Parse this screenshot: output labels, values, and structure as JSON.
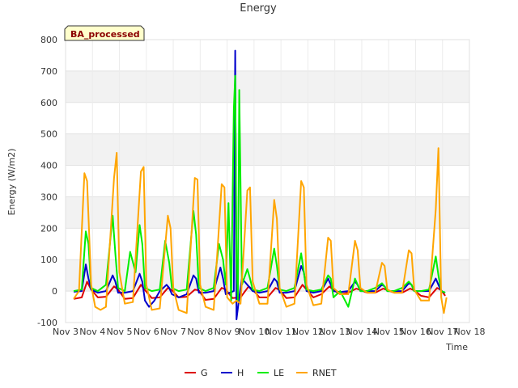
{
  "chart_data": {
    "type": "line",
    "title": "Energy",
    "badge": "BA_processed",
    "xlabel": "Time",
    "ylabel": "Energy (W/m2)",
    "ylim": [
      -100,
      800
    ],
    "xlim": [
      3,
      18
    ],
    "yticks": [
      -100,
      0,
      100,
      200,
      300,
      400,
      500,
      600,
      700,
      800
    ],
    "xticks": [
      3,
      4,
      5,
      6,
      7,
      8,
      9,
      10,
      11,
      12,
      13,
      14,
      15,
      16,
      17,
      18
    ],
    "xtick_labels": [
      "Nov 3",
      "Nov 4",
      "Nov 5",
      "Nov 6",
      "Nov 7",
      "Nov 8",
      "Nov 9",
      "Nov 10",
      "Nov 11",
      "Nov 12",
      "Nov 13",
      "Nov 14",
      "Nov 15",
      "Nov 16",
      "Nov 17",
      "Nov 18"
    ],
    "grid": true,
    "banded_background": true,
    "legend_position": "bottom",
    "series": [
      {
        "name": "G",
        "color": "#dd0000",
        "x": [
          3.3,
          3.6,
          3.8,
          3.95,
          4.2,
          4.5,
          4.8,
          4.95,
          5.2,
          5.5,
          5.8,
          5.95,
          6.2,
          6.5,
          6.8,
          6.95,
          7.2,
          7.5,
          7.8,
          7.95,
          8.2,
          8.5,
          8.8,
          8.95,
          9.2,
          9.5,
          9.8,
          9.95,
          10.2,
          10.5,
          10.8,
          10.95,
          11.2,
          11.5,
          11.8,
          11.95,
          12.2,
          12.5,
          12.8,
          12.95,
          13.2,
          13.5,
          13.8,
          13.95,
          14.2,
          14.5,
          14.8,
          14.95,
          15.2,
          15.5,
          15.8,
          15.95,
          16.2,
          16.5,
          16.8,
          16.95,
          17.1
        ],
        "y": [
          -25,
          -20,
          30,
          5,
          -20,
          -18,
          15,
          5,
          -25,
          -22,
          20,
          3,
          -22,
          -20,
          10,
          3,
          -20,
          -18,
          5,
          2,
          -28,
          -25,
          10,
          5,
          -22,
          -20,
          15,
          5,
          -20,
          -20,
          10,
          3,
          -22,
          -20,
          20,
          5,
          -20,
          -10,
          15,
          3,
          -10,
          -5,
          8,
          3,
          -5,
          -5,
          8,
          3,
          -5,
          -5,
          8,
          2,
          -15,
          -20,
          10,
          3,
          -15
        ]
      },
      {
        "name": "H",
        "color": "#0000cc",
        "x": [
          3.3,
          3.6,
          3.75,
          3.85,
          3.95,
          4.2,
          4.5,
          4.75,
          4.85,
          4.95,
          5.2,
          5.5,
          5.75,
          5.85,
          5.95,
          6.1,
          6.3,
          6.5,
          6.75,
          6.85,
          6.95,
          7.2,
          7.5,
          7.75,
          7.85,
          7.95,
          8.2,
          8.5,
          8.75,
          8.85,
          8.95,
          9.1,
          9.25,
          9.3,
          9.35,
          9.45,
          9.55,
          9.75,
          9.85,
          9.95,
          10.2,
          10.5,
          10.75,
          10.85,
          10.95,
          11.2,
          11.5,
          11.75,
          11.85,
          11.95,
          12.2,
          12.5,
          12.75,
          12.85,
          12.95,
          13.2,
          13.5,
          13.75,
          13.85,
          13.95,
          14.2,
          14.5,
          14.75,
          14.85,
          14.95,
          15.2,
          15.5,
          15.75,
          15.85,
          15.95,
          16.2,
          16.5,
          16.75,
          16.85,
          16.95,
          17.1
        ],
        "y": [
          -2,
          0,
          85,
          40,
          5,
          -5,
          0,
          50,
          30,
          -5,
          -5,
          0,
          55,
          30,
          -30,
          -50,
          -30,
          0,
          20,
          10,
          -10,
          -20,
          -10,
          50,
          40,
          -5,
          -5,
          0,
          75,
          40,
          -10,
          -5,
          0,
          765,
          -90,
          -20,
          40,
          20,
          10,
          0,
          -5,
          0,
          40,
          30,
          -5,
          -5,
          0,
          80,
          60,
          0,
          -5,
          0,
          40,
          20,
          0,
          -3,
          0,
          30,
          20,
          0,
          0,
          0,
          20,
          15,
          0,
          0,
          0,
          25,
          20,
          0,
          0,
          0,
          40,
          20,
          0,
          -5
        ]
      },
      {
        "name": "LE",
        "color": "#00ee00",
        "x": [
          3.3,
          3.6,
          3.75,
          3.85,
          3.95,
          4.2,
          4.5,
          4.75,
          4.85,
          4.95,
          5.2,
          5.4,
          5.6,
          5.75,
          5.85,
          5.95,
          6.2,
          6.5,
          6.7,
          6.85,
          6.95,
          7.2,
          7.5,
          7.75,
          7.85,
          7.95,
          8.2,
          8.5,
          8.7,
          8.85,
          8.95,
          9.05,
          9.15,
          9.25,
          9.3,
          9.35,
          9.4,
          9.45,
          9.55,
          9.75,
          9.85,
          9.95,
          10.2,
          10.5,
          10.75,
          10.85,
          10.95,
          11.2,
          11.5,
          11.75,
          11.85,
          11.95,
          12.2,
          12.5,
          12.75,
          12.85,
          12.95,
          13.2,
          13.5,
          13.75,
          13.85,
          13.95,
          14.2,
          14.5,
          14.75,
          14.85,
          14.95,
          15.2,
          15.5,
          15.75,
          15.85,
          15.95,
          16.2,
          16.5,
          16.75,
          16.85,
          16.95,
          17.1
        ],
        "y": [
          0,
          5,
          190,
          150,
          10,
          0,
          20,
          240,
          120,
          10,
          0,
          125,
          60,
          210,
          150,
          10,
          0,
          5,
          160,
          90,
          10,
          0,
          5,
          255,
          180,
          10,
          0,
          10,
          150,
          100,
          20,
          280,
          -30,
          580,
          685,
          100,
          -30,
          640,
          20,
          70,
          40,
          5,
          0,
          10,
          135,
          80,
          5,
          0,
          10,
          120,
          60,
          5,
          0,
          5,
          50,
          40,
          -20,
          0,
          -50,
          40,
          20,
          0,
          0,
          10,
          25,
          15,
          0,
          0,
          10,
          30,
          20,
          0,
          0,
          5,
          110,
          50,
          0,
          -5
        ]
      },
      {
        "name": "RNET",
        "color": "#ffa500",
        "x": [
          3.3,
          3.5,
          3.7,
          3.8,
          3.95,
          4.1,
          4.3,
          4.5,
          4.8,
          4.9,
          5.0,
          5.2,
          5.5,
          5.8,
          5.9,
          6.0,
          6.2,
          6.5,
          6.8,
          6.9,
          7.0,
          7.2,
          7.5,
          7.8,
          7.9,
          8.0,
          8.2,
          8.5,
          8.8,
          8.9,
          9.0,
          9.2,
          9.35,
          9.5,
          9.75,
          9.85,
          9.95,
          10.2,
          10.5,
          10.75,
          10.85,
          10.95,
          11.2,
          11.5,
          11.75,
          11.85,
          11.95,
          12.2,
          12.5,
          12.75,
          12.85,
          12.95,
          13.2,
          13.5,
          13.75,
          13.85,
          13.95,
          14.2,
          14.5,
          14.75,
          14.85,
          14.95,
          15.2,
          15.5,
          15.75,
          15.85,
          15.95,
          16.2,
          16.5,
          16.75,
          16.85,
          16.95,
          17.05,
          17.15
        ],
        "y": [
          -25,
          0,
          375,
          350,
          20,
          -50,
          -60,
          -50,
          360,
          440,
          60,
          -40,
          -35,
          380,
          395,
          20,
          -60,
          -55,
          240,
          200,
          10,
          -60,
          -70,
          360,
          355,
          20,
          -50,
          -60,
          340,
          330,
          -20,
          -40,
          -30,
          -40,
          320,
          330,
          30,
          -40,
          -40,
          290,
          230,
          10,
          -50,
          -40,
          350,
          330,
          20,
          -45,
          -40,
          170,
          160,
          10,
          -10,
          -10,
          160,
          130,
          10,
          -5,
          -5,
          90,
          80,
          5,
          -5,
          -5,
          130,
          120,
          5,
          -30,
          -30,
          260,
          455,
          -20,
          -70,
          -20
        ]
      }
    ]
  }
}
